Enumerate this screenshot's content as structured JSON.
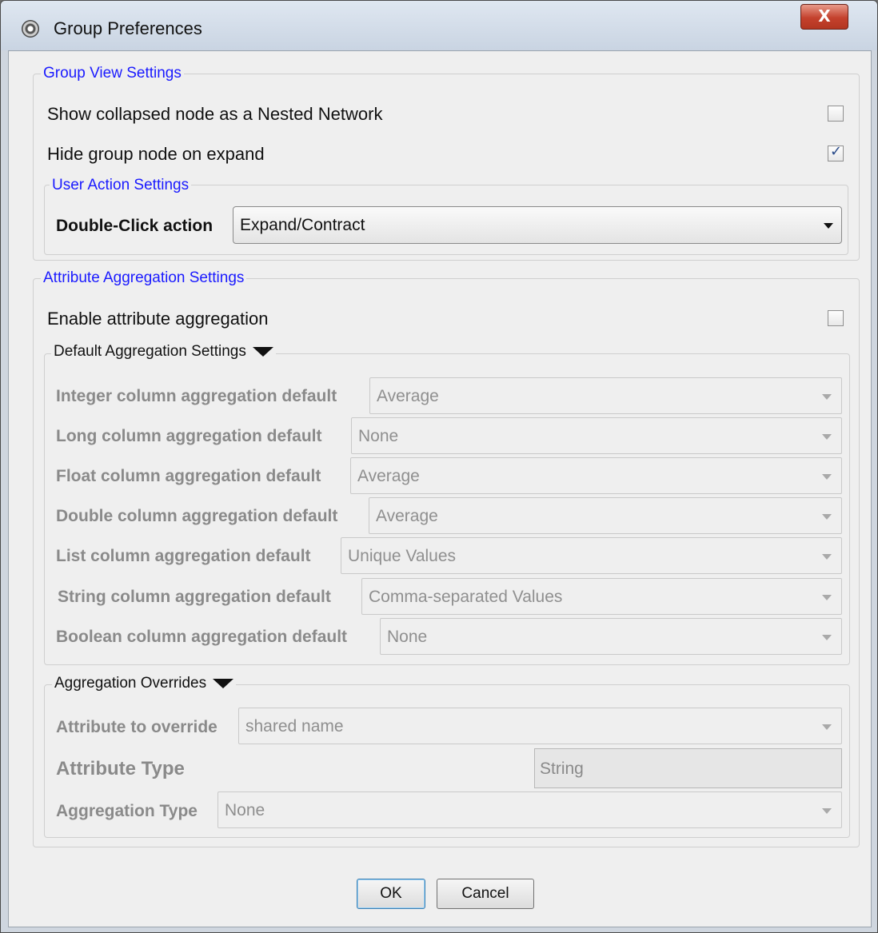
{
  "window": {
    "title": "Group Preferences",
    "close_label": "X"
  },
  "group_view": {
    "legend": "Group View Settings",
    "show_collapsed_label": "Show collapsed node as a Nested Network",
    "show_collapsed_checked": false,
    "hide_group_label": "Hide group node on expand",
    "hide_group_checked": true
  },
  "user_action": {
    "legend": "User Action Settings",
    "double_click_label": "Double-Click action",
    "double_click_value": "Expand/Contract"
  },
  "attribute_aggregation": {
    "legend": "Attribute Aggregation Settings",
    "enable_label": "Enable attribute aggregation",
    "enable_checked": false
  },
  "default_aggregation": {
    "legend": "Default Aggregation Settings",
    "rows": [
      {
        "label": "Integer column aggregation default",
        "value": "Average"
      },
      {
        "label": "Long column aggregation default",
        "value": "None"
      },
      {
        "label": "Float column aggregation default",
        "value": "Average"
      },
      {
        "label": "Double column aggregation default",
        "value": "Average"
      },
      {
        "label": "List column aggregation default",
        "value": "Unique Values"
      },
      {
        "label": "String column aggregation default",
        "value": "Comma-separated Values"
      },
      {
        "label": "Boolean column aggregation default",
        "value": "None"
      }
    ]
  },
  "overrides": {
    "legend": "Aggregation Overrides",
    "attribute_label": "Attribute to override",
    "attribute_value": "shared name",
    "type_label": "Attribute Type",
    "type_value": "String",
    "aggregation_label": "Aggregation Type",
    "aggregation_value": "None"
  },
  "buttons": {
    "ok": "OK",
    "cancel": "Cancel"
  }
}
